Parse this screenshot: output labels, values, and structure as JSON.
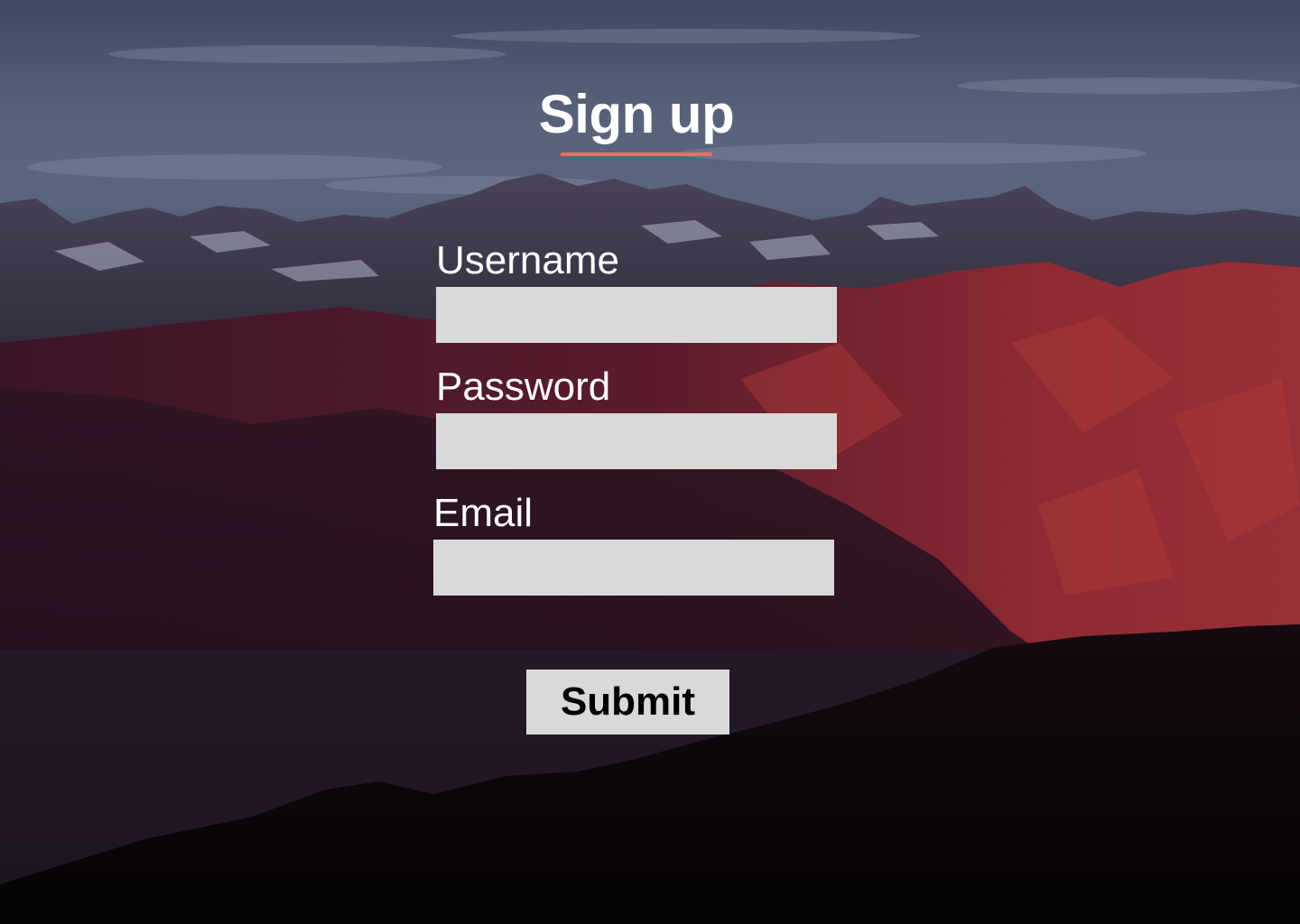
{
  "page": {
    "background": "mountain-landscape-dusk",
    "title": "Sign up",
    "accent_color": "#f26b63",
    "field_color": "#d9d9d9",
    "text_color": "#ffffff"
  },
  "form": {
    "fields": [
      {
        "label": "Username",
        "value": "",
        "placeholder": ""
      },
      {
        "label": "Password",
        "value": "",
        "placeholder": ""
      },
      {
        "label": "Email",
        "value": "",
        "placeholder": ""
      }
    ],
    "submit_label": "Submit"
  }
}
